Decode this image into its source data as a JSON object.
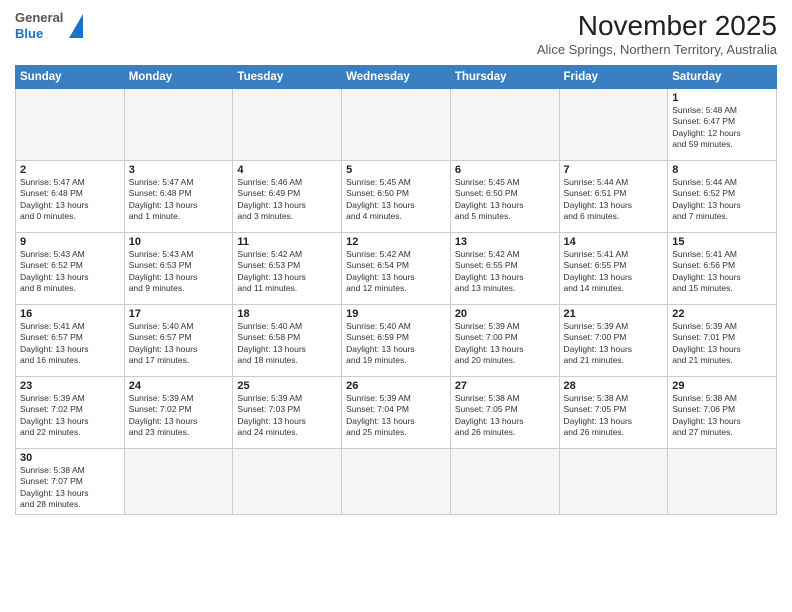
{
  "header": {
    "logo_general": "General",
    "logo_blue": "Blue",
    "month_title": "November 2025",
    "location": "Alice Springs, Northern Territory, Australia"
  },
  "weekdays": [
    "Sunday",
    "Monday",
    "Tuesday",
    "Wednesday",
    "Thursday",
    "Friday",
    "Saturday"
  ],
  "weeks": [
    [
      {
        "day": "",
        "info": ""
      },
      {
        "day": "",
        "info": ""
      },
      {
        "day": "",
        "info": ""
      },
      {
        "day": "",
        "info": ""
      },
      {
        "day": "",
        "info": ""
      },
      {
        "day": "",
        "info": ""
      },
      {
        "day": "1",
        "info": "Sunrise: 5:48 AM\nSunset: 6:47 PM\nDaylight: 12 hours\nand 59 minutes."
      }
    ],
    [
      {
        "day": "2",
        "info": "Sunrise: 5:47 AM\nSunset: 6:48 PM\nDaylight: 13 hours\nand 0 minutes."
      },
      {
        "day": "3",
        "info": "Sunrise: 5:47 AM\nSunset: 6:48 PM\nDaylight: 13 hours\nand 1 minute."
      },
      {
        "day": "4",
        "info": "Sunrise: 5:46 AM\nSunset: 6:49 PM\nDaylight: 13 hours\nand 3 minutes."
      },
      {
        "day": "5",
        "info": "Sunrise: 5:45 AM\nSunset: 6:50 PM\nDaylight: 13 hours\nand 4 minutes."
      },
      {
        "day": "6",
        "info": "Sunrise: 5:45 AM\nSunset: 6:50 PM\nDaylight: 13 hours\nand 5 minutes."
      },
      {
        "day": "7",
        "info": "Sunrise: 5:44 AM\nSunset: 6:51 PM\nDaylight: 13 hours\nand 6 minutes."
      },
      {
        "day": "8",
        "info": "Sunrise: 5:44 AM\nSunset: 6:52 PM\nDaylight: 13 hours\nand 7 minutes."
      }
    ],
    [
      {
        "day": "9",
        "info": "Sunrise: 5:43 AM\nSunset: 6:52 PM\nDaylight: 13 hours\nand 8 minutes."
      },
      {
        "day": "10",
        "info": "Sunrise: 5:43 AM\nSunset: 6:53 PM\nDaylight: 13 hours\nand 9 minutes."
      },
      {
        "day": "11",
        "info": "Sunrise: 5:42 AM\nSunset: 6:53 PM\nDaylight: 13 hours\nand 11 minutes."
      },
      {
        "day": "12",
        "info": "Sunrise: 5:42 AM\nSunset: 6:54 PM\nDaylight: 13 hours\nand 12 minutes."
      },
      {
        "day": "13",
        "info": "Sunrise: 5:42 AM\nSunset: 6:55 PM\nDaylight: 13 hours\nand 13 minutes."
      },
      {
        "day": "14",
        "info": "Sunrise: 5:41 AM\nSunset: 6:55 PM\nDaylight: 13 hours\nand 14 minutes."
      },
      {
        "day": "15",
        "info": "Sunrise: 5:41 AM\nSunset: 6:56 PM\nDaylight: 13 hours\nand 15 minutes."
      }
    ],
    [
      {
        "day": "16",
        "info": "Sunrise: 5:41 AM\nSunset: 6:57 PM\nDaylight: 13 hours\nand 16 minutes."
      },
      {
        "day": "17",
        "info": "Sunrise: 5:40 AM\nSunset: 6:57 PM\nDaylight: 13 hours\nand 17 minutes."
      },
      {
        "day": "18",
        "info": "Sunrise: 5:40 AM\nSunset: 6:58 PM\nDaylight: 13 hours\nand 18 minutes."
      },
      {
        "day": "19",
        "info": "Sunrise: 5:40 AM\nSunset: 6:59 PM\nDaylight: 13 hours\nand 19 minutes."
      },
      {
        "day": "20",
        "info": "Sunrise: 5:39 AM\nSunset: 7:00 PM\nDaylight: 13 hours\nand 20 minutes."
      },
      {
        "day": "21",
        "info": "Sunrise: 5:39 AM\nSunset: 7:00 PM\nDaylight: 13 hours\nand 21 minutes."
      },
      {
        "day": "22",
        "info": "Sunrise: 5:39 AM\nSunset: 7:01 PM\nDaylight: 13 hours\nand 21 minutes."
      }
    ],
    [
      {
        "day": "23",
        "info": "Sunrise: 5:39 AM\nSunset: 7:02 PM\nDaylight: 13 hours\nand 22 minutes."
      },
      {
        "day": "24",
        "info": "Sunrise: 5:39 AM\nSunset: 7:02 PM\nDaylight: 13 hours\nand 23 minutes."
      },
      {
        "day": "25",
        "info": "Sunrise: 5:39 AM\nSunset: 7:03 PM\nDaylight: 13 hours\nand 24 minutes."
      },
      {
        "day": "26",
        "info": "Sunrise: 5:39 AM\nSunset: 7:04 PM\nDaylight: 13 hours\nand 25 minutes."
      },
      {
        "day": "27",
        "info": "Sunrise: 5:38 AM\nSunset: 7:05 PM\nDaylight: 13 hours\nand 26 minutes."
      },
      {
        "day": "28",
        "info": "Sunrise: 5:38 AM\nSunset: 7:05 PM\nDaylight: 13 hours\nand 26 minutes."
      },
      {
        "day": "29",
        "info": "Sunrise: 5:38 AM\nSunset: 7:06 PM\nDaylight: 13 hours\nand 27 minutes."
      }
    ],
    [
      {
        "day": "30",
        "info": "Sunrise: 5:38 AM\nSunset: 7:07 PM\nDaylight: 13 hours\nand 28 minutes."
      },
      {
        "day": "",
        "info": ""
      },
      {
        "day": "",
        "info": ""
      },
      {
        "day": "",
        "info": ""
      },
      {
        "day": "",
        "info": ""
      },
      {
        "day": "",
        "info": ""
      },
      {
        "day": "",
        "info": ""
      }
    ]
  ]
}
